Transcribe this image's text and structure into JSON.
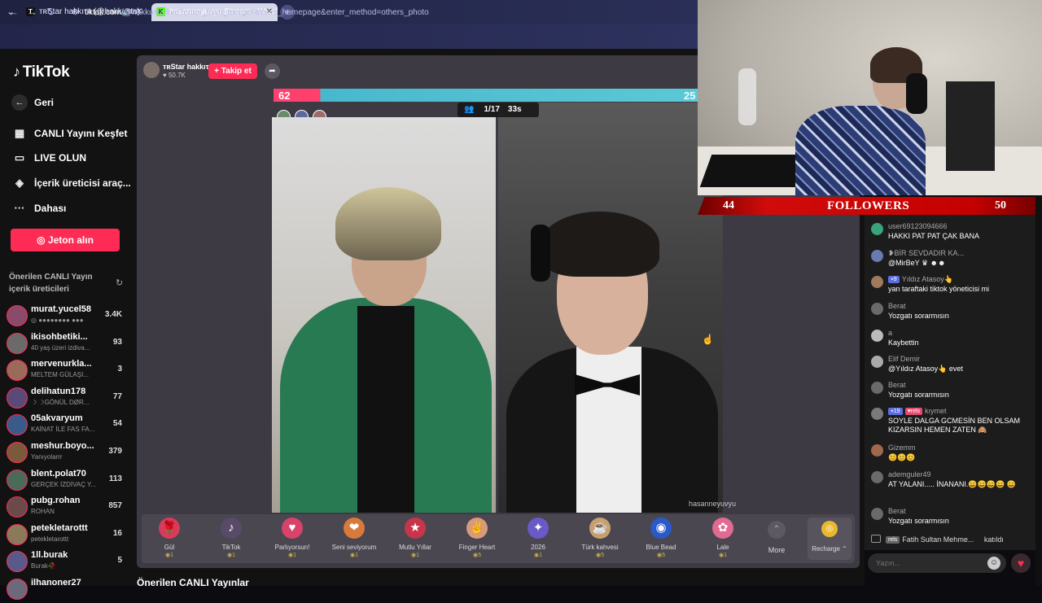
{
  "browser": {
    "tabs": [
      {
        "title": "ᴛʀStar hakkıτя (@hakkusta)",
        "favicon": "T"
      },
      {
        "title": "hasanneyuvyu Stream - Watch",
        "favicon": "K"
      }
    ],
    "url_domain": "tiktok.com",
    "url_path": "/@hakkusta/live?enter_from_merge=others_homepage&enter_method=others_photo"
  },
  "sidebar": {
    "logo": "TikTok",
    "nav": [
      {
        "label": "Geri",
        "icon": "back-arrow-icon"
      },
      {
        "label": "CANLI Yayını Keşfet",
        "icon": "calendar-icon"
      },
      {
        "label": "LIVE OLUN",
        "icon": "video-camera-icon"
      },
      {
        "label": "İçerik üreticisi araç...",
        "icon": "lightbulb-icon"
      },
      {
        "label": "Dahası",
        "icon": "more-icon"
      }
    ],
    "coins_button": "Jeton alın",
    "suggested_title": "Önerilen CANLI Yayın içerik üreticileri",
    "creators": [
      {
        "name": "murat.yucel58",
        "sub": "◎ ●●●●●●●● ●●●",
        "viewers": "3.4K",
        "color": "#8a4a6a"
      },
      {
        "name": "ikisohbetiki...",
        "sub": "40 yaş üzeri izdiva...",
        "viewers": "93",
        "color": "#6a6a6a"
      },
      {
        "name": "mervenurkla...",
        "sub": "MELTEM GÜLAŞI...",
        "viewers": "3",
        "color": "#9a6a5a"
      },
      {
        "name": "delihatun178",
        "sub": "☽ ☽GÖNÜL DØR...",
        "viewers": "77",
        "color": "#5a4a7a"
      },
      {
        "name": "05akvaryum",
        "sub": "KAİNAT İLE FAS FA...",
        "viewers": "54",
        "color": "#3a5a8a"
      },
      {
        "name": "meshur.boyo...",
        "sub": "Yanıyolarrr",
        "viewers": "379",
        "color": "#7a5a3a"
      },
      {
        "name": "blent.polat70",
        "sub": "GERÇEK İZDİVAÇ Y...",
        "viewers": "113",
        "color": "#4a6a5a"
      },
      {
        "name": "pubg.rohan",
        "sub": "ROHAN",
        "viewers": "857",
        "color": "#6a4a4a"
      },
      {
        "name": "petekletarottt",
        "sub": "petekletarottt",
        "viewers": "16",
        "color": "#8a7a5a"
      },
      {
        "name": "1ll.burak",
        "sub": "Burak🥀",
        "viewers": "5",
        "color": "#5a5a8a"
      },
      {
        "name": "ilhanoner27",
        "sub": "",
        "viewers": "",
        "color": "#6a6a7a"
      }
    ]
  },
  "live": {
    "host_name": "ᴛʀStar hakkıτя",
    "host_likes": "♥ 50.7K",
    "follow_button": "+ Takip et",
    "score_left": "62",
    "score_right": "25",
    "round": "1/17",
    "timer": "33s",
    "watermark": "hasanneyuvyu"
  },
  "gifts": [
    {
      "name": "Gül",
      "price": "1",
      "icon": "🌹",
      "bg": "#d63b5a"
    },
    {
      "name": "TikTok",
      "price": "1",
      "icon": "♪",
      "bg": "#5a4a6a"
    },
    {
      "name": "Parlıyorsun!",
      "price": "1",
      "icon": "♥",
      "bg": "#d8436a"
    },
    {
      "name": "Seni seviyorum",
      "price": "1",
      "icon": "❤",
      "bg": "#d87a3a"
    },
    {
      "name": "Mutlu Yıllar",
      "price": "1",
      "icon": "★",
      "bg": "#c8354a"
    },
    {
      "name": "Finger Heart",
      "price": "5",
      "icon": "✌",
      "bg": "#d89a7a"
    },
    {
      "name": "2026",
      "price": "1",
      "icon": "✦",
      "bg": "#6a5ac8"
    },
    {
      "name": "Türk kahvesi",
      "price": "5",
      "icon": "☕",
      "bg": "#c8a070"
    },
    {
      "name": "Blue Bead",
      "price": "5",
      "icon": "◉",
      "bg": "#2a5ac8"
    },
    {
      "name": "Lale",
      "price": "1",
      "icon": "✿",
      "bg": "#e06a90"
    }
  ],
  "more_label": "More",
  "recharge_label": "Recharge ⌃",
  "recommended_title": "Önerilen CANLI Yayınlar",
  "overlay": {
    "followers_left": "44",
    "followers_label": "FOLLOWERS",
    "followers_right": "50"
  },
  "chat": {
    "messages": [
      {
        "user": "user69123094666",
        "text": "HAKKI PAT PAT ÇAK BANA",
        "color": "#3aa57a"
      },
      {
        "user": "❥BİR SEVDADIR KA...",
        "text": "@MirBeY ♛ ☻☻",
        "color": "#6a7ab0"
      },
      {
        "user": "Yıldız Atasoy👆",
        "badge": "⭑9",
        "text": "yan taraftaki tiktok yöneticisi mi",
        "color": "#a07a5a"
      },
      {
        "user": "Berat",
        "text": "Yozgatı sorarmısın",
        "color": "#6a6a6a"
      },
      {
        "user": "a",
        "text": "Kaybettin",
        "color": "#bbbbbb"
      },
      {
        "user": "Elif Demir",
        "text": "@Yıldız Atasoy👆 evet",
        "color": "#aaaaaa"
      },
      {
        "user": "Berat",
        "text": "Yozgatı sorarmısın",
        "color": "#6a6a6a"
      },
      {
        "user": "kıymet",
        "badge": "⭑19",
        "badge2": "♥rels",
        "text": "SOYLE DALGA GCMESİN BEN OLSAM KIZARSIN HEMEN ZATEN 🙈",
        "color": "#7a7a7a"
      },
      {
        "user": "Gizemm",
        "text": "😊😊😊",
        "color": "#a06a4a"
      },
      {
        "user": "ademguler49",
        "text": "AT YALANI..... İNANANI.😄😄😄😄 😄",
        "color": "#6a6a6a"
      },
      {
        "user": "Berat",
        "text": "Yozgatı sorarmısın",
        "color": "#6a6a6a"
      }
    ],
    "joined_badge": "rels",
    "joined_user": "Fatih Sultan Mehme...",
    "joined_text": "katıldı",
    "input_placeholder": "Yazın..."
  }
}
